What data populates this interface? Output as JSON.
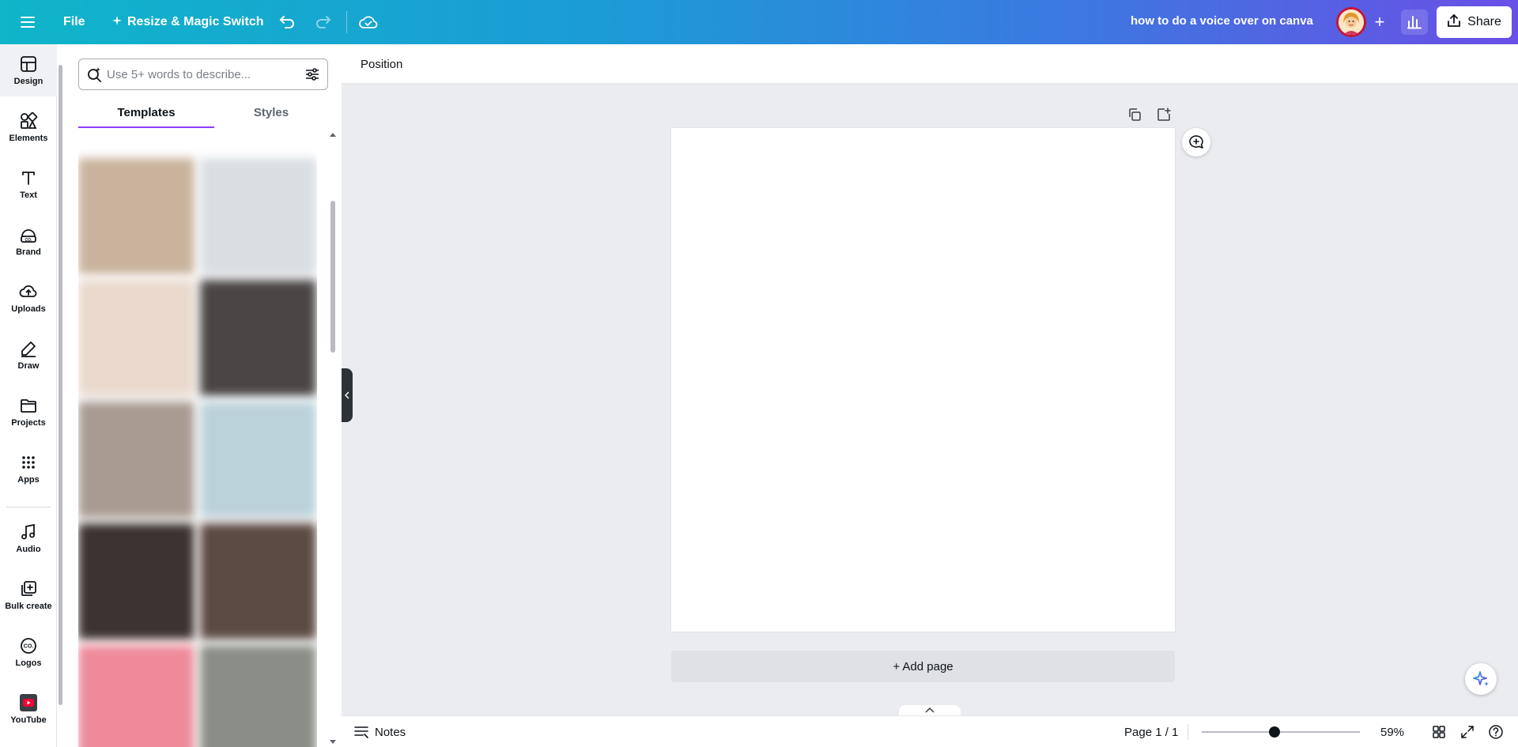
{
  "topbar": {
    "file_label": "File",
    "resize_label": "Resize & Magic Switch",
    "doc_title": "how to do a voice over on canva",
    "share_label": "Share",
    "plus_label": "+"
  },
  "rail": {
    "items": [
      {
        "label": "Design",
        "icon": "design-icon"
      },
      {
        "label": "Elements",
        "icon": "elements-icon"
      },
      {
        "label": "Text",
        "icon": "text-icon"
      },
      {
        "label": "Brand",
        "icon": "brand-icon"
      },
      {
        "label": "Uploads",
        "icon": "uploads-icon"
      },
      {
        "label": "Draw",
        "icon": "draw-icon"
      },
      {
        "label": "Projects",
        "icon": "projects-icon"
      },
      {
        "label": "Apps",
        "icon": "apps-icon"
      },
      {
        "label": "Audio",
        "icon": "audio-icon"
      },
      {
        "label": "Bulk create",
        "icon": "bulk-create-icon"
      },
      {
        "label": "Logos",
        "icon": "logos-icon"
      },
      {
        "label": "YouTube",
        "icon": "youtube-icon"
      }
    ]
  },
  "panel": {
    "search_placeholder": "Use 5+ words to describe...",
    "tabs": [
      {
        "label": "Templates",
        "active": true
      },
      {
        "label": "Styles",
        "active": false
      }
    ],
    "thumbnail_colors": [
      "#c9b39d",
      "#d9dee3",
      "#ead9cc",
      "#4a4646",
      "#a89c92",
      "#bcd2da",
      "#3d3330",
      "#5c4a44",
      "#ee8a9a",
      "#8a8e86"
    ]
  },
  "context_bar": {
    "position_label": "Position"
  },
  "canvas": {
    "add_page_label": "+ Add page"
  },
  "bottom_bar": {
    "notes_label": "Notes",
    "page_label": "Page 1 / 1",
    "zoom_label": "59%",
    "zoom_level": 0.59
  },
  "colors": {
    "accent": "#8b3dff",
    "topbar_start": "#0fb5c9",
    "topbar_end": "#6a4fe6"
  }
}
